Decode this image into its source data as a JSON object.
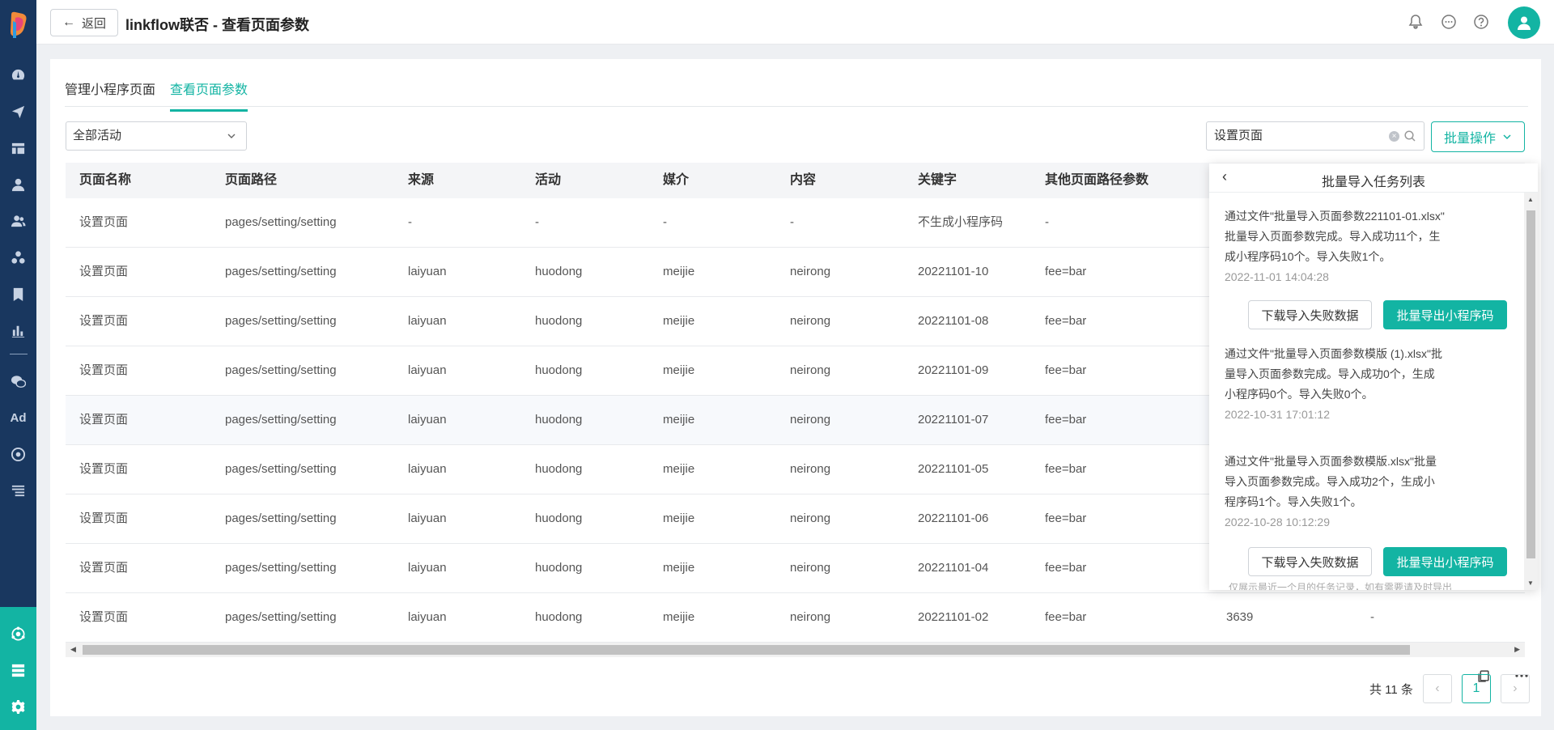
{
  "header": {
    "back_label": "返回",
    "title": "linkflow联否 - 查看页面参数"
  },
  "tabs": [
    {
      "label": "管理小程序页面",
      "active": false
    },
    {
      "label": "查看页面参数",
      "active": true
    }
  ],
  "filters": {
    "activity_select_value": "全部活动",
    "search_value": "设置页面"
  },
  "batch_button_label": "批量操作",
  "table": {
    "columns": [
      "页面名称",
      "页面路径",
      "来源",
      "活动",
      "媒介",
      "内容",
      "关键字",
      "其他页面路径参数"
    ],
    "rows": [
      [
        "设置页面",
        "pages/setting/setting",
        "-",
        "-",
        "-",
        "-",
        "不生成小程序码",
        "-"
      ],
      [
        "设置页面",
        "pages/setting/setting",
        "laiyuan",
        "huodong",
        "meijie",
        "neirong",
        "20221101-10",
        "fee=bar"
      ],
      [
        "设置页面",
        "pages/setting/setting",
        "laiyuan",
        "huodong",
        "meijie",
        "neirong",
        "20221101-08",
        "fee=bar"
      ],
      [
        "设置页面",
        "pages/setting/setting",
        "laiyuan",
        "huodong",
        "meijie",
        "neirong",
        "20221101-09",
        "fee=bar"
      ],
      [
        "设置页面",
        "pages/setting/setting",
        "laiyuan",
        "huodong",
        "meijie",
        "neirong",
        "20221101-07",
        "fee=bar"
      ],
      [
        "设置页面",
        "pages/setting/setting",
        "laiyuan",
        "huodong",
        "meijie",
        "neirong",
        "20221101-05",
        "fee=bar"
      ],
      [
        "设置页面",
        "pages/setting/setting",
        "laiyuan",
        "huodong",
        "meijie",
        "neirong",
        "20221101-06",
        "fee=bar"
      ],
      [
        "设置页面",
        "pages/setting/setting",
        "laiyuan",
        "huodong",
        "meijie",
        "neirong",
        "20221101-04",
        "fee=bar"
      ],
      [
        "设置页面",
        "pages/setting/setting",
        "laiyuan",
        "huodong",
        "meijie",
        "neirong",
        "20221101-02",
        "fee=bar"
      ]
    ],
    "last_row_extra": [
      "3639",
      "-"
    ]
  },
  "pagination": {
    "total_label": "共 11 条",
    "current_page": "1"
  },
  "popover": {
    "title": "批量导入任务列表",
    "tasks": [
      {
        "lines": [
          "通过文件\"批量导入页面参数221101-01.xlsx\"",
          "批量导入页面参数完成。导入成功11个，生",
          "成小程序码10个。导入失败1个。"
        ],
        "date": "2022-11-01 14:04:28",
        "has_buttons": true
      },
      {
        "lines": [
          "通过文件\"批量导入页面参数模版 (1).xlsx\"批",
          "量导入页面参数完成。导入成功0个，生成",
          "小程序码0个。导入失败0个。"
        ],
        "date": "2022-10-31 17:01:12",
        "has_buttons": false
      },
      {
        "lines": [
          "通过文件\"批量导入页面参数模版.xlsx\"批量",
          "导入页面参数完成。导入成功2个，生成小",
          "程序码1个。导入失败1个。"
        ],
        "date": "2022-10-28 10:12:29",
        "has_buttons": true
      }
    ],
    "download_failed_label": "下载导入失败数据",
    "export_codes_label": "批量导出小程序码",
    "footer_hint": "仅展示最近一个月的任务记录，如有需要请及时导出"
  },
  "colors": {
    "accent": "#13b4a3",
    "sidebar_bg": "#19375f"
  }
}
